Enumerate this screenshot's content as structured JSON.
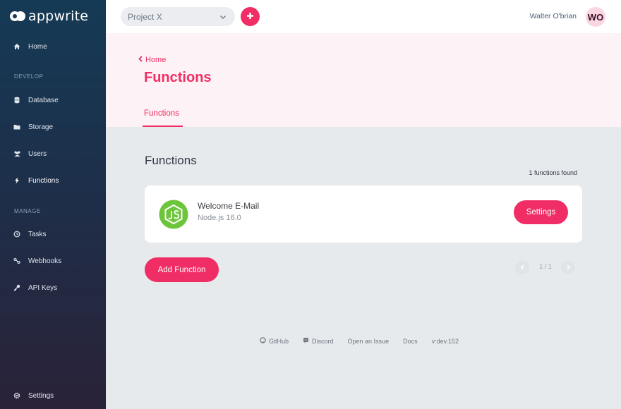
{
  "brand": {
    "name": "appwrite"
  },
  "sidebar": {
    "home": {
      "label": "Home",
      "icon": "home-icon"
    },
    "develop_title": "DEVELOP",
    "develop": [
      {
        "label": "Database",
        "icon": "database-icon"
      },
      {
        "label": "Storage",
        "icon": "folder-icon"
      },
      {
        "label": "Users",
        "icon": "users-icon"
      },
      {
        "label": "Functions",
        "icon": "lightning-icon",
        "active": true
      }
    ],
    "manage_title": "MANAGE",
    "manage": [
      {
        "label": "Tasks",
        "icon": "clock-icon"
      },
      {
        "label": "Webhooks",
        "icon": "webhook-icon"
      },
      {
        "label": "API Keys",
        "icon": "key-icon"
      }
    ],
    "settings": {
      "label": "Settings",
      "icon": "gear-icon"
    }
  },
  "topbar": {
    "project": "Project X",
    "user_name": "Walter O'brian",
    "avatar_initials": "WO"
  },
  "header": {
    "breadcrumb": "Home",
    "title": "Functions",
    "tabs": [
      {
        "label": "Functions",
        "active": true
      }
    ]
  },
  "main": {
    "heading": "Functions",
    "found": "1 functions found",
    "functions": [
      {
        "name": "Welcome E-Mail",
        "runtime": "Node.js 16.0",
        "settings_label": "Settings"
      }
    ],
    "add_label": "Add Function",
    "pagination": "1 / 1"
  },
  "footer": {
    "links": [
      {
        "label": "GitHub",
        "icon": "github-icon"
      },
      {
        "label": "Discord",
        "icon": "discord-icon"
      },
      {
        "label": "Open an Issue"
      },
      {
        "label": "Docs"
      }
    ],
    "version": "v:dev.152"
  },
  "colors": {
    "accent": "#f02e65",
    "sidebar_top": "#153a55",
    "sidebar_bottom": "#2a2238",
    "header_bg": "#fdf2f5",
    "content_bg": "#e7eaed"
  }
}
